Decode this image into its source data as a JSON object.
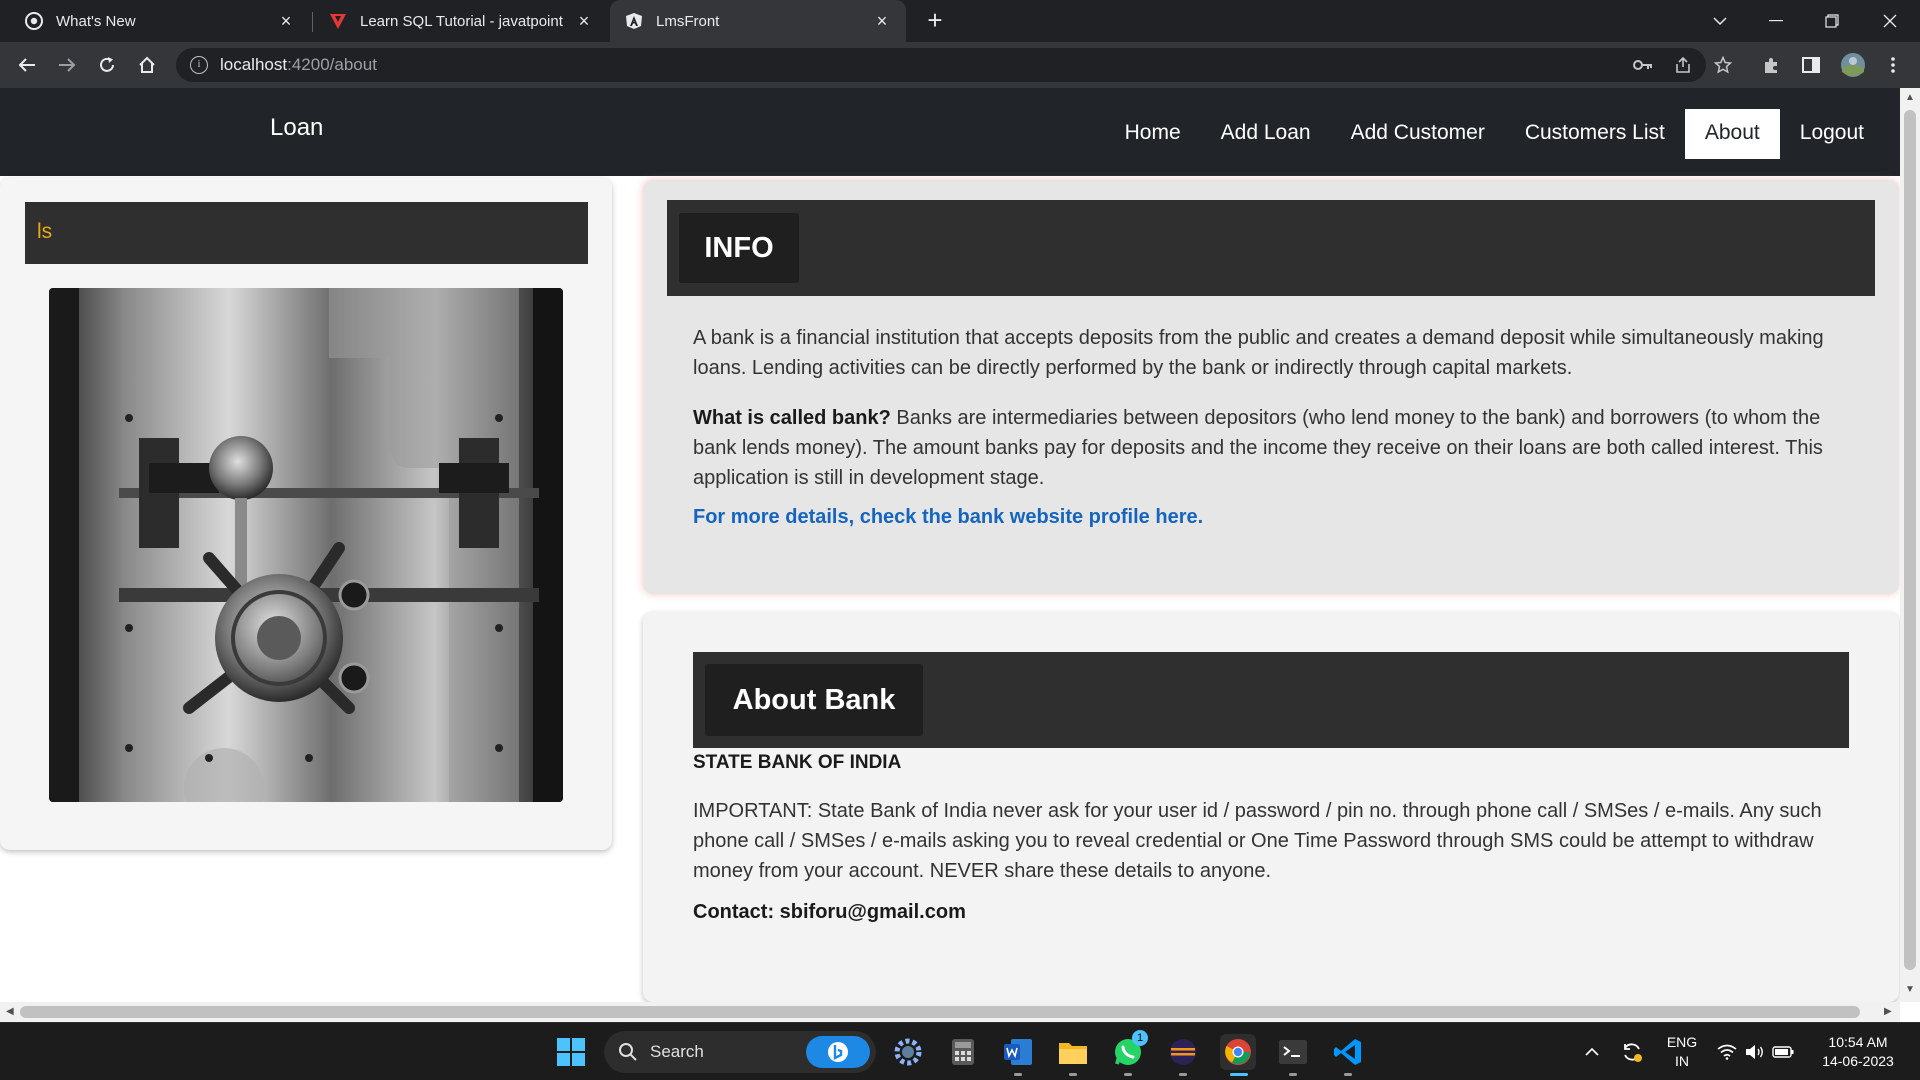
{
  "browser": {
    "tabs": [
      {
        "title": "What's New",
        "close": "×"
      },
      {
        "title": "Learn SQL Tutorial - javatpoint",
        "close": "×"
      },
      {
        "title": "LmsFront",
        "close": "×"
      }
    ],
    "new_tab": "+",
    "url_host": "localhost",
    "url_path": ":4200/about"
  },
  "navbar": {
    "brand": "Loan",
    "links": [
      "Home",
      "Add Loan",
      "Add Customer",
      "Customers List",
      "About",
      "Logout"
    ],
    "active": "About"
  },
  "left_card": {
    "header_text": "ls",
    "image": "bank-vault-door"
  },
  "info": {
    "title": "INFO",
    "para1": "A bank is a financial institution that accepts deposits from the public and creates a demand deposit while simultaneously making loans. Lending activities can be directly performed by the bank or indirectly through capital markets.",
    "question": "What is called bank?",
    "para2": " Banks are intermediaries between depositors (who lend money to the bank) and borrowers (to whom the bank lends money). The amount banks pay for deposits and the income they receive on their loans are both called interest. This application is still in development stage.",
    "link": "For more details, check the bank website profile here."
  },
  "about": {
    "title": "About Bank",
    "bank_name": "STATE BANK OF INDIA",
    "important": "IMPORTANT: State Bank of India never ask for your user id / password / pin no. through phone call / SMSes / e-mails. Any such phone call / SMSes / e-mails asking you to reveal credential or One Time Password through SMS could be attempt to withdraw money from your account. NEVER share these details to anyone.",
    "contact": "Contact: sbiforu@gmail.com"
  },
  "taskbar": {
    "search_label": "Search",
    "whatsapp_badge": "1",
    "lang_top": "ENG",
    "lang_bottom": "IN",
    "time": "10:54 AM",
    "date": "14-06-2023"
  },
  "colors": {
    "navbar_bg": "#212529",
    "link": "#1565c0",
    "accent_text": "#e8a916",
    "band_bg": "#2f2f2f"
  }
}
